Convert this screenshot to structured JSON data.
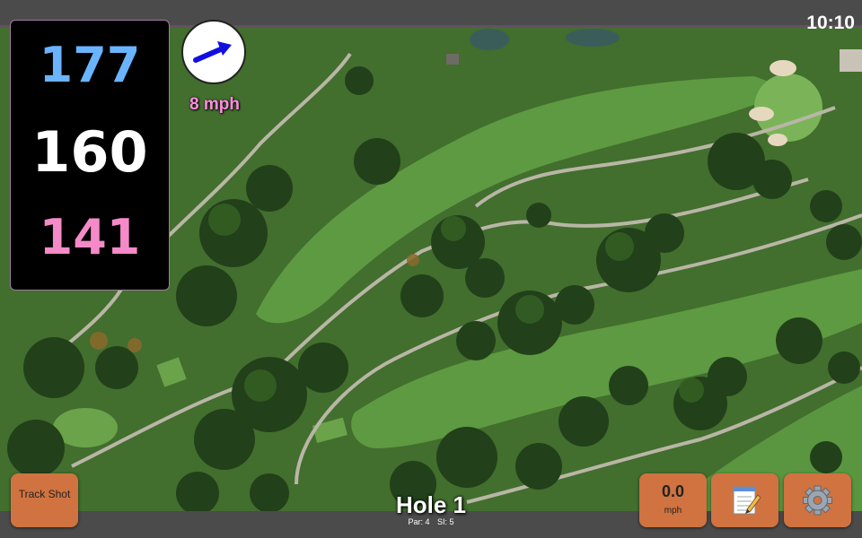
{
  "status": {
    "time": "10:10"
  },
  "distances": {
    "back": "177",
    "middle": "160",
    "front": "141"
  },
  "wind": {
    "speed": "8 mph",
    "direction_icon": "arrow-right-icon"
  },
  "hole": {
    "title": "Hole 1",
    "par": "Par: 4",
    "stroke_index": "SI: 5"
  },
  "buttons": {
    "track_shot": "Track Shot",
    "shot_speed_value": "0.0",
    "shot_speed_unit": "mph",
    "notes_icon": "notepad-icon",
    "settings_icon": "gear-icon"
  },
  "colors": {
    "back_distance": "#6ab4ff",
    "middle_distance": "#ffffff",
    "front_distance": "#f48ac8",
    "wind_text": "#ff8ce0",
    "button": "#d07340",
    "wind_arrow": "#1010e0"
  }
}
